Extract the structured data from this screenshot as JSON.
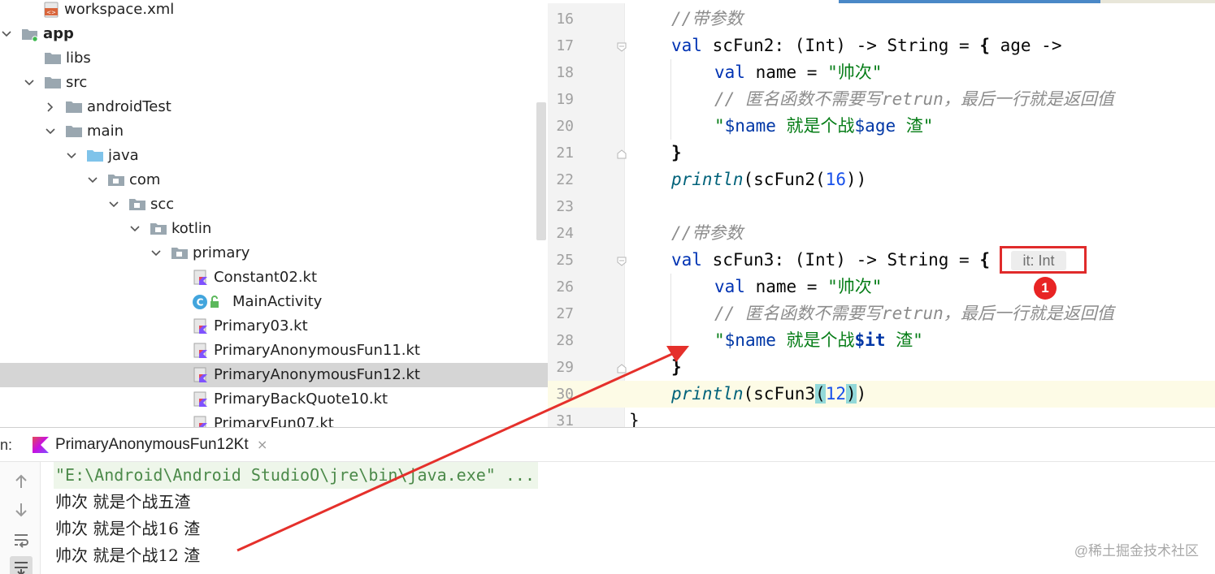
{
  "project_tree": {
    "items": [
      {
        "label": "workspace.xml",
        "icon": "xml-file-icon",
        "chevron": "none"
      },
      {
        "label": "app",
        "icon": "module-folder-icon",
        "chevron": "down",
        "bold": true
      },
      {
        "label": "libs",
        "icon": "folder-icon",
        "chevron": "none"
      },
      {
        "label": "src",
        "icon": "folder-icon",
        "chevron": "down"
      },
      {
        "label": "androidTest",
        "icon": "folder-icon",
        "chevron": "right"
      },
      {
        "label": "main",
        "icon": "folder-icon",
        "chevron": "down"
      },
      {
        "label": "java",
        "icon": "source-folder-icon",
        "chevron": "down"
      },
      {
        "label": "com",
        "icon": "package-icon",
        "chevron": "down"
      },
      {
        "label": "scc",
        "icon": "package-icon",
        "chevron": "down"
      },
      {
        "label": "kotlin",
        "icon": "package-icon",
        "chevron": "down"
      },
      {
        "label": "primary",
        "icon": "package-icon",
        "chevron": "down"
      },
      {
        "label": "Constant02.kt",
        "icon": "kotlin-file-icon",
        "chevron": "none"
      },
      {
        "label": "MainActivity",
        "icon": "class-icon",
        "chevron": "none"
      },
      {
        "label": "Primary03.kt",
        "icon": "kotlin-file-icon",
        "chevron": "none"
      },
      {
        "label": "PrimaryAnonymousFun11.kt",
        "icon": "kotlin-file-icon",
        "chevron": "none"
      },
      {
        "label": "PrimaryAnonymousFun12.kt",
        "icon": "kotlin-file-icon",
        "chevron": "none",
        "selected": true
      },
      {
        "label": "PrimaryBackQuote10.kt",
        "icon": "kotlin-file-icon",
        "chevron": "none"
      },
      {
        "label": "PrimaryFun07.kt",
        "icon": "kotlin-file-icon",
        "chevron": "none"
      }
    ]
  },
  "editor": {
    "line_numbers": [
      "16",
      "17",
      "18",
      "19",
      "20",
      "21",
      "22",
      "23",
      "24",
      "25",
      "26",
      "27",
      "28",
      "29",
      "30",
      "31"
    ],
    "l16": {
      "comment": "//带参数"
    },
    "l17": {
      "kw": "val",
      "decl": " scFun2: (Int) -> String = ",
      "brace": "{",
      "param": " age ->"
    },
    "l18": {
      "kw": "val",
      "decl": " name = ",
      "str": "\"帅次\""
    },
    "l19": {
      "comment": "// 匿名函数不需要写retrun，最后一行就是返回值"
    },
    "l20": {
      "q1": "\"",
      "t1": "$name",
      "s1": " 就是个战",
      "t2": "$age",
      "s2": " 渣\""
    },
    "l21": {
      "text": "}"
    },
    "l22": {
      "fn": "println",
      "a": "(scFun2(",
      "num": "16",
      "b": "))"
    },
    "l24": {
      "comment": "//带参数"
    },
    "l25": {
      "kw": "val",
      "decl": " scFun3: (Int) -> String = ",
      "brace": "{"
    },
    "l26": {
      "kw": "val",
      "decl": " name = ",
      "str": "\"帅次\""
    },
    "l27": {
      "comment": "// 匿名函数不需要写retrun，最后一行就是返回值"
    },
    "l28": {
      "q1": "\"",
      "t1": "$name",
      "s1": " 就是个战",
      "t2": "$it",
      "s2": " 渣\""
    },
    "l29": {
      "text": "}"
    },
    "l30": {
      "fn": "println",
      "a": "(scFun3",
      "p1": "(",
      "num": "12",
      "p2": ")",
      "b": ")"
    },
    "l31": {
      "text": "}"
    },
    "inlay_hint": "it: Int",
    "badge": "1"
  },
  "run_panel": {
    "prefix": "n:",
    "tab_label": "PrimaryAnonymousFun12Kt",
    "tab_close": "×",
    "console_lines": [
      "\"E:\\Android\\Android StudioO\\jre\\bin\\java.exe\" ...",
      "帅次 就是个战五渣",
      "帅次 就是个战16 渣",
      "帅次 就是个战12 渣"
    ]
  },
  "watermark": "@稀土掘金技术社区",
  "colors": {
    "accent_tab": "#4a88c7",
    "annotation_red": "#e02b2b",
    "selection": "#d5d5d5"
  }
}
